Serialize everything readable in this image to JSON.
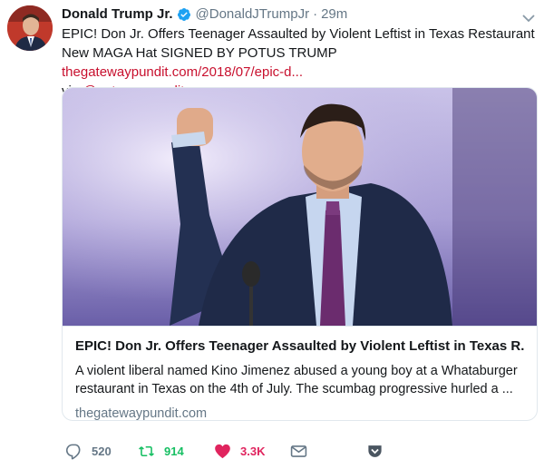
{
  "tweet": {
    "display_name": "Donald Trump Jr.",
    "verified": true,
    "handle": "@DonaldJTrumpJr",
    "separator": "·",
    "time": "29m",
    "text_main": "EPIC! Don Jr. Offers Teenager Assaulted by Violent Leftist in Texas Restaurant New MAGA Hat SIGNED BY POTUS TRUMP",
    "text_link": "thegatewaypundit.com/2018/07/epic-d...",
    "via_label": "via",
    "via_handle": "@gatewaypundit"
  },
  "card": {
    "title": "EPIC! Don Jr. Offers Teenager Assaulted by Violent Leftist in Texas R...",
    "description": "A violent liberal named Kino Jimenez abused a young boy at a Whataburger restaurant in Texas on the 4th of July. The scumbag progressive hurled a ...",
    "domain": "thegatewaypundit.com"
  },
  "actions": {
    "reply_count": "520",
    "retweet_count": "914",
    "like_count": "3.3K"
  },
  "colors": {
    "link": "#c8102e",
    "retweet": "#17bf63",
    "like": "#e0245e",
    "muted": "#657786",
    "verified": "#1da1f2"
  },
  "icons": [
    "verified-badge-icon",
    "chevron-down-icon",
    "reply-icon",
    "retweet-icon",
    "heart-icon",
    "envelope-icon",
    "bookmark-icon"
  ]
}
